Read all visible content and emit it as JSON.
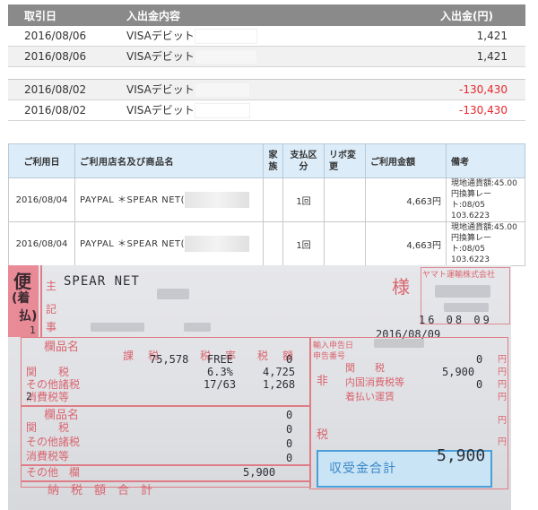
{
  "transactions": {
    "headers": {
      "date": "取引日",
      "desc": "入出金内容",
      "amount": "入出金(円)"
    },
    "group1": [
      {
        "date": "2016/08/06",
        "desc": "VISAデビット",
        "amount": "1,421",
        "negative": false
      },
      {
        "date": "2016/08/06",
        "desc": "VISAデビット",
        "amount": "1,421",
        "negative": false
      }
    ],
    "group2": [
      {
        "date": "2016/08/02",
        "desc": "VISAデビット",
        "amount": "-130,430",
        "negative": true
      },
      {
        "date": "2016/08/02",
        "desc": "VISAデビット",
        "amount": "-130,430",
        "negative": true
      }
    ]
  },
  "card_statement": {
    "headers": {
      "date": "ご利用日",
      "name": "ご利用店名及び商品名",
      "family": "家族",
      "payment": "支払区分",
      "revolving": "リボ変更",
      "amount": "ご利用金額",
      "notes": "備考"
    },
    "rows": [
      {
        "date": "2016/08/04",
        "name": "PAYPAL ＊SPEAR NET(",
        "payment": "1回",
        "amount": "4,663円",
        "note1": "現地通貨額:45.00",
        "note2": "円換算レート:08/05",
        "note3": "103.6223"
      },
      {
        "date": "2016/08/04",
        "name": "PAYPAL ＊SPEAR NET(",
        "payment": "1回",
        "amount": "4,663円",
        "note1": "現地通貨額:45.00",
        "note2": "円換算レート:08/05",
        "note3": "103.6223"
      }
    ]
  },
  "slip": {
    "sender": "SPEAR NET",
    "sama": "様",
    "company": "ヤマト運輸株式会社",
    "date_short": "16 08 09",
    "date_full": "2016/08/09",
    "left_labels": {
      "bin": "便",
      "chaku": "(着",
      "barai": "払)",
      "nushi": "主",
      "ki": "記",
      "ji": "事",
      "one": "1",
      "hinmei": "欄品名",
      "kazei": "課",
      "kanzei": "関　　税",
      "sonota": "その他諸税",
      "shohizei": "消費税等",
      "two": "2",
      "hinmei2": "欄品名",
      "kanzei2": "関　　税",
      "sonota2": "その他諸税",
      "shohizei2": "消費税等",
      "sonotaran": "その他　欄",
      "nouzei": "納　税　額　合　計"
    },
    "values": {
      "kazei_value": "75,578",
      "free": "FREE",
      "zero1": "0",
      "rate": "6.3%",
      "kanzei_amt": "4,725",
      "ratio": "17/63",
      "shohi_amt": "1,268",
      "z2": "0",
      "z3": "0",
      "z4": "0",
      "z5": "0",
      "total_other": "5,900"
    },
    "right": {
      "yunyu": "輸入申告日",
      "shinkoku": "申告番号",
      "hi": "非",
      "kanzei": "関　　税",
      "naikoku": "内国消費税等",
      "chakubarai": "着払い運賃",
      "zei": "税",
      "amt_zero_top": "0",
      "amt_kanzei": "5,900",
      "amt_naikoku": "0",
      "en1": "円",
      "en2": "円",
      "en3": "円",
      "en4": "円",
      "en5": "円",
      "en6": "円",
      "shuju": "収受金合計",
      "total": "5,900"
    },
    "headers_row": {
      "kazei": "課　税",
      "rate": "税　率",
      "tax": "税　額"
    }
  }
}
